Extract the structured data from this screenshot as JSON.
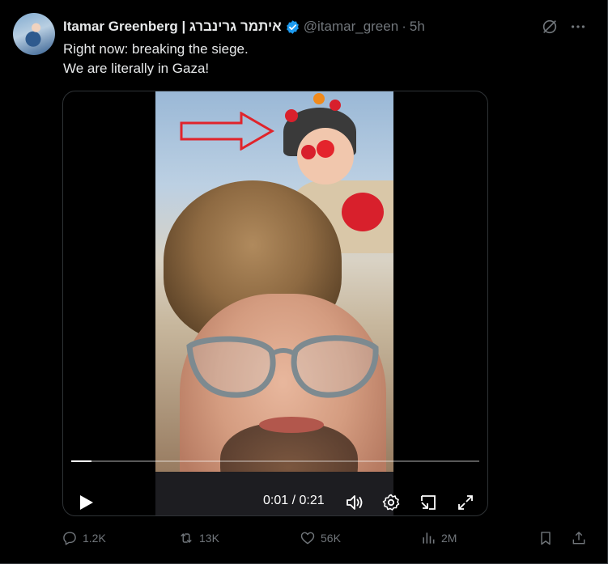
{
  "tweet": {
    "display_name": "Itamar Greenberg | איתמר גרינברג",
    "handle": "@itamar_green",
    "separator": "·",
    "time": "5h",
    "text_lines": [
      "Right now: breaking the siege.",
      "We are literally in Gaza!"
    ]
  },
  "video": {
    "time_display": "0:01 / 0:21",
    "progress_fraction": 0.05,
    "accent_annotation_color": "#e0242b"
  },
  "actions": {
    "replies": "1.2K",
    "reposts": "13K",
    "likes": "56K",
    "views": "2M"
  },
  "colors": {
    "background": "#000000",
    "text": "#e7e9ea",
    "muted": "#71767b",
    "verified": "#1d9bf0"
  },
  "icons": [
    "grok-icon",
    "more-icon",
    "verified-icon",
    "play-icon",
    "volume-icon",
    "settings-icon",
    "pip-icon",
    "fullscreen-icon",
    "reply-icon",
    "repost-icon",
    "like-icon",
    "views-icon",
    "bookmark-icon",
    "share-icon"
  ]
}
